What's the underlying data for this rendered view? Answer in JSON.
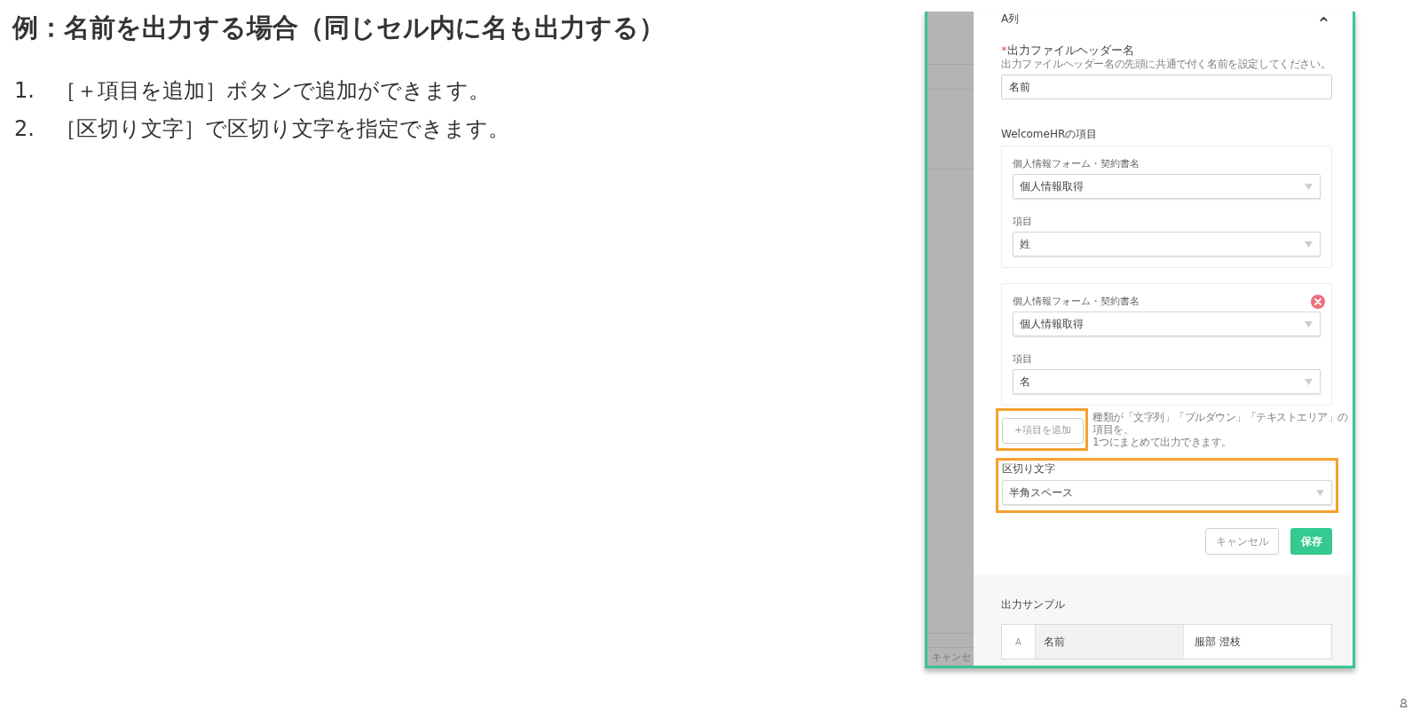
{
  "heading": "例：名前を出力する場合（同じセル内に名も出力する）",
  "steps": [
    {
      "number": "1.",
      "text": "［＋項目を追加］ボタンで追加ができます。"
    },
    {
      "number": "2.",
      "text": "［区切り文字］で区切り文字を指定できます。"
    }
  ],
  "screenshot": {
    "background": {
      "text": "キャンセ"
    },
    "section": {
      "title": "A列",
      "expanded": true
    },
    "header_name": {
      "required_mark": "*",
      "label": "出力ファイルヘッダー名",
      "hint": "出力ファイルヘッダー名の先頭に共通で付く名前を設定してください。",
      "value": "名前"
    },
    "items_title": "WelcomeHRの項目",
    "item_groups": [
      {
        "removable": false,
        "fields": [
          {
            "label": "個人情報フォーム・契約書名",
            "value": "個人情報取得"
          },
          {
            "label": "項目",
            "value": "姓"
          }
        ]
      },
      {
        "removable": true,
        "fields": [
          {
            "label": "個人情報フォーム・契約書名",
            "value": "個人情報取得"
          },
          {
            "label": "項目",
            "value": "名"
          }
        ]
      }
    ],
    "add_button": {
      "label": "+項目を追加",
      "highlighted": true,
      "hint": "種類が「文字列」「プルダウン」「テキストエリア」の項目を、\n1つにまとめて出力できます。"
    },
    "separator": {
      "label": "区切り文字",
      "value": "半角スペース",
      "highlighted": true
    },
    "buttons": [
      {
        "kind": "secondary",
        "label": "キャンセル"
      },
      {
        "kind": "primary",
        "label": "保存"
      }
    ],
    "sample": {
      "title": "出力サンプル",
      "column": "A",
      "header": "名前",
      "value": "服部 澄枝"
    }
  }
}
